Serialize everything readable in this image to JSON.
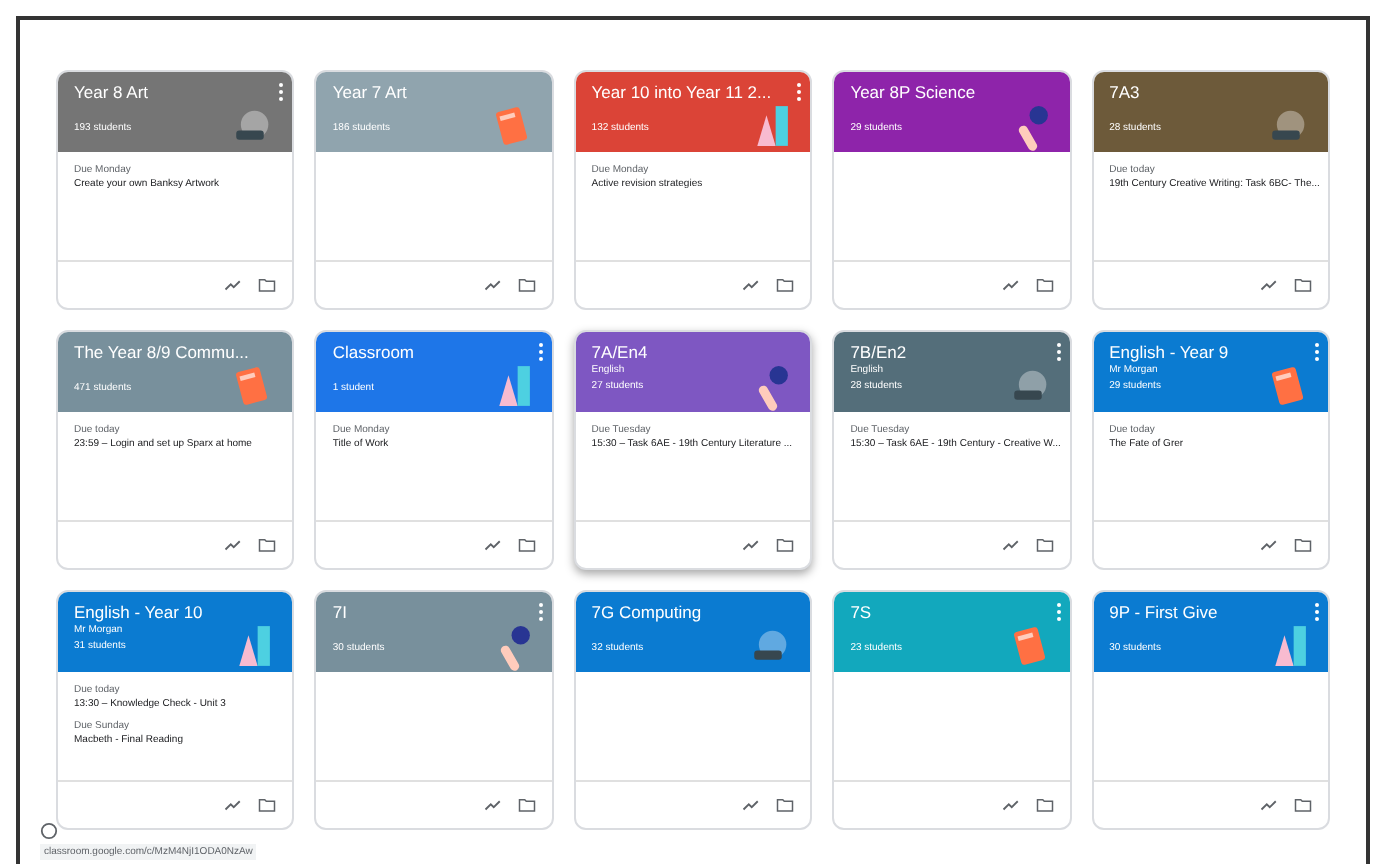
{
  "cards": [
    {
      "title": "Year 8 Art",
      "students": "193 students",
      "color": "#757575",
      "menu": true,
      "hovered": false,
      "due": [
        {
          "label": "Due Monday",
          "task": "Create your own Banksy Artwork"
        }
      ]
    },
    {
      "title": "Year 7 Art",
      "students": "186 students",
      "color": "#90a4ae",
      "menu": false,
      "hovered": false
    },
    {
      "title": "Year 10 into Year 11 2...",
      "students": "132 students",
      "color": "#db4437",
      "menu": true,
      "hovered": false,
      "due": [
        {
          "label": "Due Monday",
          "task": "Active revision strategies"
        }
      ]
    },
    {
      "title": "Year 8P Science",
      "students": "29 students",
      "color": "#8e24aa",
      "menu": false,
      "hovered": false
    },
    {
      "title": "7A3",
      "students": "28 students",
      "color": "#6d5a3a",
      "menu": false,
      "hovered": false,
      "due": [
        {
          "label": "Due today",
          "task": "19th Century Creative Writing: Task 6BC- The..."
        }
      ]
    },
    {
      "title": "The Year 8/9 Commu...",
      "students": "471 students",
      "color": "#78909c",
      "menu": false,
      "hovered": false,
      "due": [
        {
          "label": "Due today",
          "task": "23:59 – Login and set up Sparx at home"
        }
      ]
    },
    {
      "title": "Classroom",
      "students": "1 student",
      "color": "#1e76e8",
      "menu": true,
      "hovered": false,
      "due": [
        {
          "label": "Due Monday",
          "task": "Title of Work"
        }
      ]
    },
    {
      "title": "7A/En4",
      "subtitle": "English",
      "students": "27 students",
      "color": "#7e57c2",
      "menu": false,
      "hovered": true,
      "due": [
        {
          "label": "Due Tuesday",
          "task": "15:30 – Task 6AE - 19th Century Literature ..."
        }
      ]
    },
    {
      "title": "7B/En2",
      "subtitle": "English",
      "students": "28 students",
      "color": "#546e7a",
      "menu": true,
      "hovered": false,
      "due": [
        {
          "label": "Due Tuesday",
          "task": "15:30 – Task 6AE - 19th Century - Creative W..."
        }
      ]
    },
    {
      "title": "English - Year 9",
      "subtitle": "Mr Morgan",
      "students": "29 students",
      "color": "#0b7bd1",
      "menu": true,
      "hovered": false,
      "due": [
        {
          "label": "Due today",
          "task": "The Fate of Grer"
        }
      ]
    },
    {
      "title": "English - Year 10",
      "subtitle": "Mr Morgan",
      "students": "31 students",
      "color": "#0b7bd1",
      "menu": false,
      "hovered": false,
      "due": [
        {
          "label": "Due today",
          "task": "13:30 – Knowledge Check - Unit 3"
        },
        {
          "label": "Due Sunday",
          "task": "Macbeth - Final Reading"
        }
      ]
    },
    {
      "title": "7I",
      "students": "30 students",
      "color": "#78909c",
      "menu": true,
      "hovered": false
    },
    {
      "title": "7G Computing",
      "students": "32 students",
      "color": "#0b7bd1",
      "menu": false,
      "hovered": false
    },
    {
      "title": "7S",
      "students": "23 students",
      "color": "#12a8bd",
      "menu": true,
      "hovered": false
    },
    {
      "title": "9P - First Give",
      "students": "30 students",
      "color": "#0b7bd1",
      "menu": true,
      "hovered": false
    }
  ],
  "status_url": "classroom.google.com/c/MzM4NjI1ODA0NzAw"
}
